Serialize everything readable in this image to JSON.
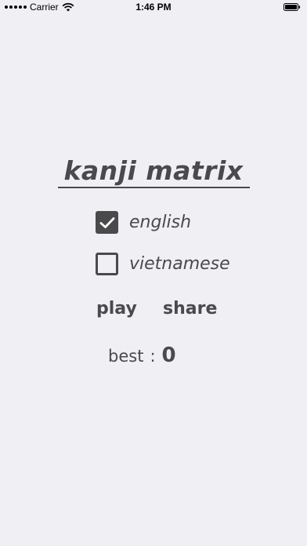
{
  "status_bar": {
    "carrier": "Carrier",
    "time": "1:46 PM"
  },
  "app": {
    "title": "kanji matrix"
  },
  "options": [
    {
      "label": "english",
      "checked": true
    },
    {
      "label": "vietnamese",
      "checked": false
    }
  ],
  "actions": {
    "play_label": "play",
    "share_label": "share"
  },
  "score": {
    "best_label": "best",
    "separator": ":",
    "best_value": "0"
  },
  "colors": {
    "background": "#efeff4",
    "foreground": "#4a4a4c"
  }
}
